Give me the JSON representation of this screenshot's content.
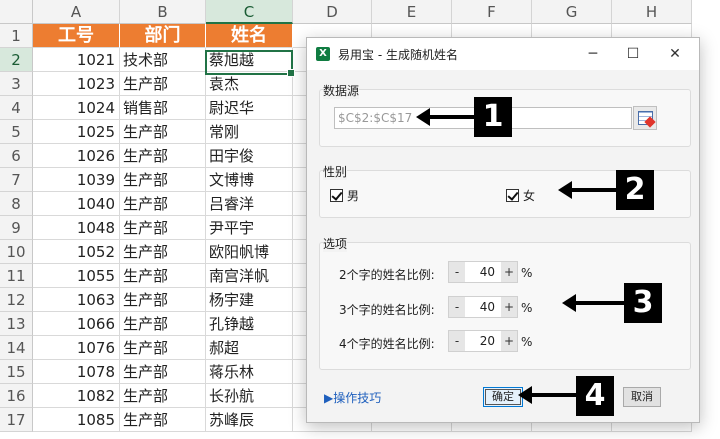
{
  "sheet": {
    "columns": [
      "A",
      "B",
      "C",
      "D",
      "E",
      "F",
      "G",
      "H"
    ],
    "rows": [
      "1",
      "2",
      "3",
      "4",
      "5",
      "6",
      "7",
      "8",
      "9",
      "10",
      "11",
      "12",
      "13",
      "14",
      "15",
      "16",
      "17"
    ],
    "header": [
      "工号",
      "部门",
      "姓名"
    ],
    "records": [
      [
        "1021",
        "技术部",
        "蔡旭越"
      ],
      [
        "1023",
        "生产部",
        "袁杰"
      ],
      [
        "1024",
        "销售部",
        "尉迟华"
      ],
      [
        "1025",
        "生产部",
        "常刚"
      ],
      [
        "1026",
        "生产部",
        "田宇俊"
      ],
      [
        "1039",
        "生产部",
        "文博博"
      ],
      [
        "1040",
        "生产部",
        "吕睿洋"
      ],
      [
        "1048",
        "生产部",
        "尹平宇"
      ],
      [
        "1052",
        "生产部",
        "欧阳帆博"
      ],
      [
        "1055",
        "生产部",
        "南宫洋帆"
      ],
      [
        "1063",
        "生产部",
        "杨宇建"
      ],
      [
        "1066",
        "生产部",
        "孔铮越"
      ],
      [
        "1076",
        "生产部",
        "郝超"
      ],
      [
        "1078",
        "生产部",
        "蒋乐林"
      ],
      [
        "1082",
        "生产部",
        "长孙航"
      ],
      [
        "1085",
        "生产部",
        "苏峰辰"
      ]
    ],
    "header_color": "#ed7d31",
    "selection_color": "#217346"
  },
  "dialog": {
    "app_icon": "excel-icon",
    "title": "易用宝 - 生成随机姓名",
    "minimize": "─",
    "maximize": "☐",
    "close": "✕",
    "source_group": "数据源",
    "source_value": "$C$2:$C$17",
    "gender_group": "性别",
    "male": "男",
    "female": "女",
    "options_group": "选项",
    "ratios": [
      {
        "label": "2个字的姓名比例:",
        "value": "40"
      },
      {
        "label": "3个字的姓名比例:",
        "value": "40"
      },
      {
        "label": "4个字的姓名比例:",
        "value": "20"
      }
    ],
    "minus": "-",
    "plus": "+",
    "percent": "%",
    "tips_link": "▶操作技巧",
    "ok": "确定",
    "cancel": "取消"
  },
  "annotations": [
    "1",
    "2",
    "3",
    "4"
  ]
}
